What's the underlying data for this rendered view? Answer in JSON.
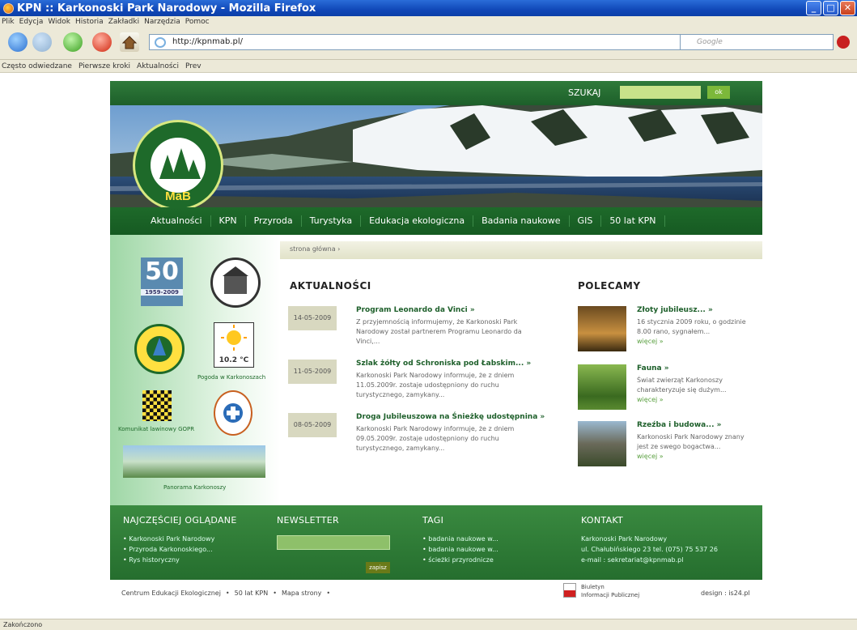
{
  "window": {
    "title": "KPN :: Karkonoski Park Narodowy - Mozilla Firefox"
  },
  "menu": [
    "Plik",
    "Edycja",
    "Widok",
    "Historia",
    "Zakładki",
    "Narzędzia",
    "Pomoc"
  ],
  "urlbar": {
    "value": "http://kpnmab.pl/"
  },
  "searchbar": {
    "placeholder": "Google"
  },
  "bookmarks": [
    "Często odwiedzane",
    "Pierwsze kroki",
    "Aktualności",
    "Prev"
  ],
  "status": "Zakończono",
  "site": {
    "search_label": "SZUKAJ",
    "search_button": "ok",
    "logo_text": "KARKONOSKI PARK NARODOWY",
    "logo_mab": "MaB",
    "nav": [
      "Aktualności",
      "KPN",
      "Przyroda",
      "Turystyka",
      "Edukacja ekologiczna",
      "Badania naukowe",
      "GIS",
      "50 lat KPN"
    ],
    "breadcrumb": "strona główna  ›",
    "left": {
      "badge50": "50",
      "badge50_years": "1959-2009",
      "weather_temp": "10.2 °C",
      "weather_label": "Pogoda w Karkonoszach",
      "avalanche_label": "Komunikat lawinowy GOPR",
      "panorama_label": "Panorama Karkonoszy"
    },
    "news": {
      "heading": "AKTUALNOŚCI",
      "items": [
        {
          "date": "14-05-2009",
          "title": "Program Leonardo da Vinci »",
          "text": "Z przyjemnością informujemy, że Karkonoski Park Narodowy został partnerem Programu Leonardo da Vinci,..."
        },
        {
          "date": "11-05-2009",
          "title": "Szlak żółty od Schroniska pod Łabskim... »",
          "text": "Karkonoski Park Narodowy informuje, że z dniem 11.05.2009r. zostaje udostępniony do ruchu turystycznego, zamykany..."
        },
        {
          "date": "08-05-2009",
          "title": "Droga Jubileuszowa na Śnieżkę udostępnina »",
          "text": "Karkonoski Park Narodowy informuje, że z dniem 09.05.2009r. zostaje udostępniony do ruchu turystycznego, zamykany..."
        }
      ]
    },
    "recommended": {
      "heading": "POLECAMY",
      "items": [
        {
          "title": "Złoty jubileusz... »",
          "text": "16 stycznia 2009 roku, o godzinie 8.00 rano, sygnałem...",
          "more": "więcej »"
        },
        {
          "title": "Fauna »",
          "text": "Świat zwierząt Karkonoszy charakteryzuje się dużym...",
          "more": "więcej »"
        },
        {
          "title": "Rzeźba i budowa... »",
          "text": "Karkonoski Park Narodowy znany jest ze swego bogactwa...",
          "more": "więcej »"
        }
      ]
    },
    "footer": {
      "most_viewed": {
        "heading": "NAJCZĘŚCIEJ OGLĄDANE",
        "items": [
          "Karkonoski Park Narodowy",
          "Przyroda Karkonoskiego...",
          "Rys historyczny"
        ]
      },
      "newsletter": {
        "heading": "NEWSLETTER",
        "button": "zapisz"
      },
      "tags": {
        "heading": "TAGI",
        "items": [
          "badania naukowe w...",
          "badania naukowe w...",
          "ścieżki przyrodnicze"
        ]
      },
      "contact": {
        "heading": "KONTAKT",
        "lines": [
          "Karkonoski Park Narodowy",
          "ul. Chałubińskiego 23 tel. (075) 75 537 26",
          "e-mail : sekretariat@kpnmab.pl"
        ]
      }
    },
    "bottom": {
      "links": [
        "Centrum Edukacji Ekologicznej",
        "50 lat KPN",
        "Mapa strony"
      ],
      "bip_line1": "Biuletyn",
      "bip_line2": "Informacji Publicznej",
      "design": "design : is24.pl"
    }
  },
  "colors": {
    "green_dark": "#1d5f2a",
    "green_footer": "#2f7a36",
    "accent_link": "#5aa040"
  }
}
